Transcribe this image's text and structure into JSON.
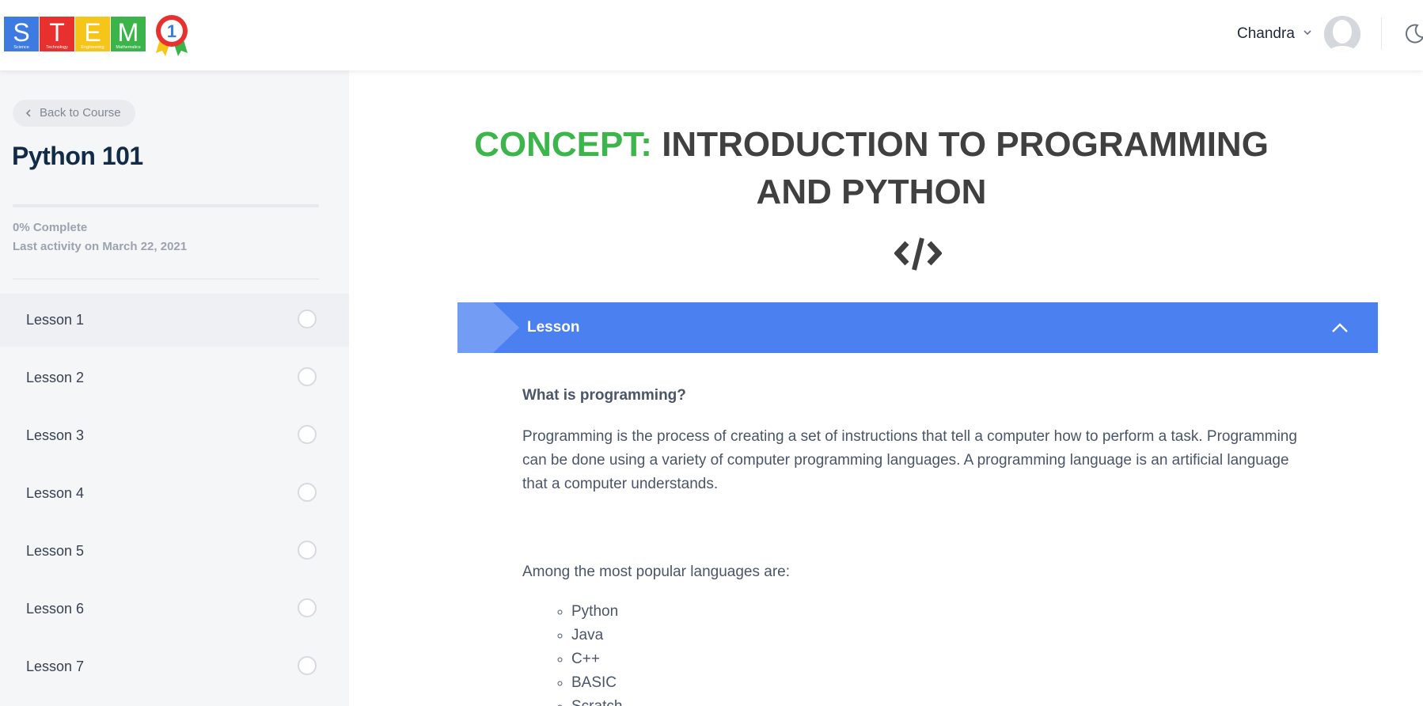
{
  "header": {
    "logo": {
      "letters": [
        "S",
        "T",
        "E",
        "M"
      ],
      "subtitles": [
        "Science",
        "Technology",
        "Engineering",
        "Mathematics"
      ],
      "tile_colors": [
        "#3d7be0",
        "#e8302f",
        "#f5c51a",
        "#3bb54a"
      ],
      "medal_number": "1"
    },
    "user_name": "Chandra",
    "icons": {
      "user_menu": "chevron-down-icon",
      "theme": "moon-icon"
    }
  },
  "sidebar": {
    "back_label": "Back to Course",
    "course_title": "Python 101",
    "progress_percent": 0,
    "progress_text": "0% Complete",
    "last_activity": "Last activity on March 22, 2021",
    "lessons": [
      {
        "label": "Lesson 1",
        "active": true
      },
      {
        "label": "Lesson 2"
      },
      {
        "label": "Lesson 3"
      },
      {
        "label": "Lesson 4"
      },
      {
        "label": "Lesson 5"
      },
      {
        "label": "Lesson 6"
      },
      {
        "label": "Lesson 7"
      }
    ]
  },
  "main": {
    "title_prefix": "CONCEPT:",
    "title_rest": "INTRODUCTION TO PROGRAMMING AND PYTHON",
    "accordion_label": "Lesson",
    "heading": "What is programming?",
    "paragraph1": "Programming is the process of creating a set of instructions that tell a computer how to perform a task. Programming can be done using a variety of computer programming languages. A programming language is an artificial language that a computer understands.",
    "paragraph2": "Among the most popular languages are:",
    "languages": [
      "Python",
      "Java",
      "C++",
      "BASIC",
      "Scratch"
    ]
  },
  "colors": {
    "accent_blue": "#4a80f0",
    "concept_green": "#3cb54a",
    "title_dark": "#122b46"
  }
}
